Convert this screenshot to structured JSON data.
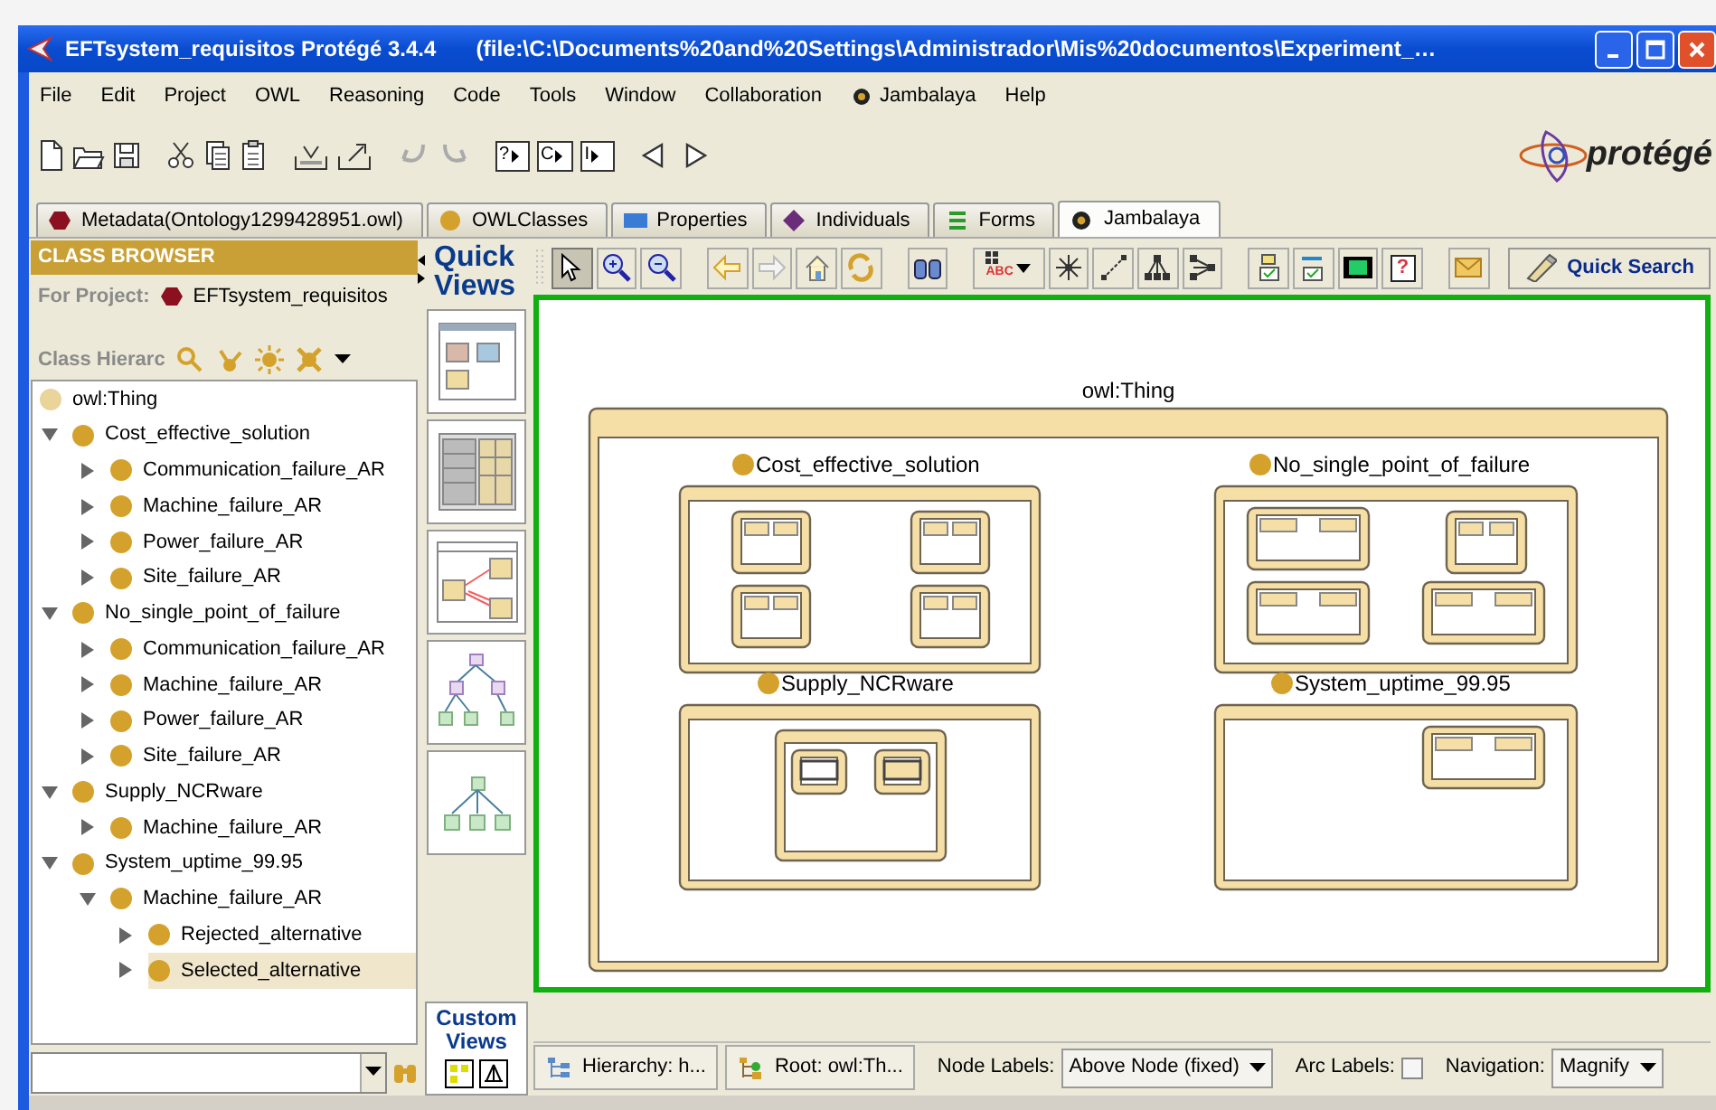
{
  "window": {
    "title": "EFTsystem_requisitos  Protégé 3.4.4",
    "path": "(file:\\C:\\Documents%20and%20Settings\\Administrador\\Mis%20documentos\\Experiment_…"
  },
  "menu": [
    {
      "label": "File",
      "kind": "text"
    },
    {
      "label": "Edit",
      "kind": "text"
    },
    {
      "label": "Project",
      "kind": "text"
    },
    {
      "label": "OWL",
      "kind": "text"
    },
    {
      "label": "Reasoning",
      "kind": "text"
    },
    {
      "label": "Code",
      "kind": "text"
    },
    {
      "label": "Tools",
      "kind": "text"
    },
    {
      "label": "Window",
      "kind": "text"
    },
    {
      "label": "Collaboration",
      "kind": "text"
    },
    {
      "label": "Jambalaya",
      "kind": "icon"
    },
    {
      "label": "Help",
      "kind": "text"
    }
  ],
  "toolbar": {
    "query_buttons": [
      "?",
      "C",
      "I"
    ],
    "logo": "protégé"
  },
  "tabs": [
    {
      "label": "Metadata(Ontology1299428951.owl)",
      "kind": "hexagon",
      "selected": false
    },
    {
      "label": "OWLClasses",
      "kind": "circle",
      "selected": false
    },
    {
      "label": "Properties",
      "kind": "square",
      "selected": false
    },
    {
      "label": "Individuals",
      "kind": "diamond",
      "selected": false
    },
    {
      "label": "Forms",
      "kind": "bars",
      "selected": false
    },
    {
      "label": "Jambalaya",
      "kind": "target",
      "selected": true
    }
  ],
  "class_browser": {
    "header": "CLASS BROWSER",
    "project_label": "For Project:",
    "project_name": "EFTsystem_requisitos",
    "hierarchy_label": "Class Hierarc",
    "tree": [
      {
        "label": "owl:Thing",
        "kind": "root",
        "selected": false,
        "children": [
          {
            "label": "Cost_effective_solution",
            "kind": "class",
            "expanded": true,
            "selected": false,
            "children": [
              {
                "label": "Communication_failure_AR",
                "kind": "class",
                "expanded": false,
                "selected": false
              },
              {
                "label": "Machine_failure_AR",
                "kind": "class",
                "expanded": false,
                "selected": false
              },
              {
                "label": "Power_failure_AR",
                "kind": "class",
                "expanded": false,
                "selected": false
              },
              {
                "label": "Site_failure_AR",
                "kind": "class",
                "expanded": false,
                "selected": false
              }
            ]
          },
          {
            "label": "No_single_point_of_failure",
            "kind": "class",
            "expanded": true,
            "selected": false,
            "children": [
              {
                "label": "Communication_failure_AR",
                "kind": "class",
                "expanded": false,
                "selected": false
              },
              {
                "label": "Machine_failure_AR",
                "kind": "class",
                "expanded": false,
                "selected": false
              },
              {
                "label": "Power_failure_AR",
                "kind": "class",
                "expanded": false,
                "selected": false
              },
              {
                "label": "Site_failure_AR",
                "kind": "class",
                "expanded": false,
                "selected": false
              }
            ]
          },
          {
            "label": "Supply_NCRware",
            "kind": "class",
            "expanded": true,
            "selected": false,
            "children": [
              {
                "label": "Machine_failure_AR",
                "kind": "class",
                "expanded": false,
                "selected": false
              }
            ]
          },
          {
            "label": "System_uptime_99.95",
            "kind": "class",
            "expanded": true,
            "selected": false,
            "children": [
              {
                "label": "Machine_failure_AR",
                "kind": "class",
                "expanded": true,
                "selected": false,
                "children": [
                  {
                    "label": "Rejected_alternative",
                    "kind": "class",
                    "expanded": false,
                    "selected": false
                  },
                  {
                    "label": "Selected_alternative",
                    "kind": "class",
                    "expanded": false,
                    "selected": true
                  }
                ]
              }
            ]
          }
        ]
      }
    ]
  },
  "quick_views": {
    "title": "Quick Views",
    "custom_title": "Custom Views"
  },
  "diagram_toolbar": {
    "layout_label": "ABC",
    "help_label": "?",
    "quick_search": "Quick Search"
  },
  "diagram": {
    "root": "owl:Thing",
    "classes": [
      {
        "label": "Cost_effective_solution"
      },
      {
        "label": "No_single_point_of_failure"
      },
      {
        "label": "Supply_NCRware"
      },
      {
        "label": "System_uptime_99.95"
      }
    ]
  },
  "status_bar": {
    "hierarchy_button": "Hierarchy: h...",
    "root_button": "Root: owl:Th...",
    "node_labels_label": "Node Labels:",
    "node_labels_value": "Above Node (fixed)",
    "arc_labels_label": "Arc Labels:",
    "arc_labels_checked": false,
    "navigation_label": "Navigation:",
    "navigation_value": "Magnify"
  }
}
